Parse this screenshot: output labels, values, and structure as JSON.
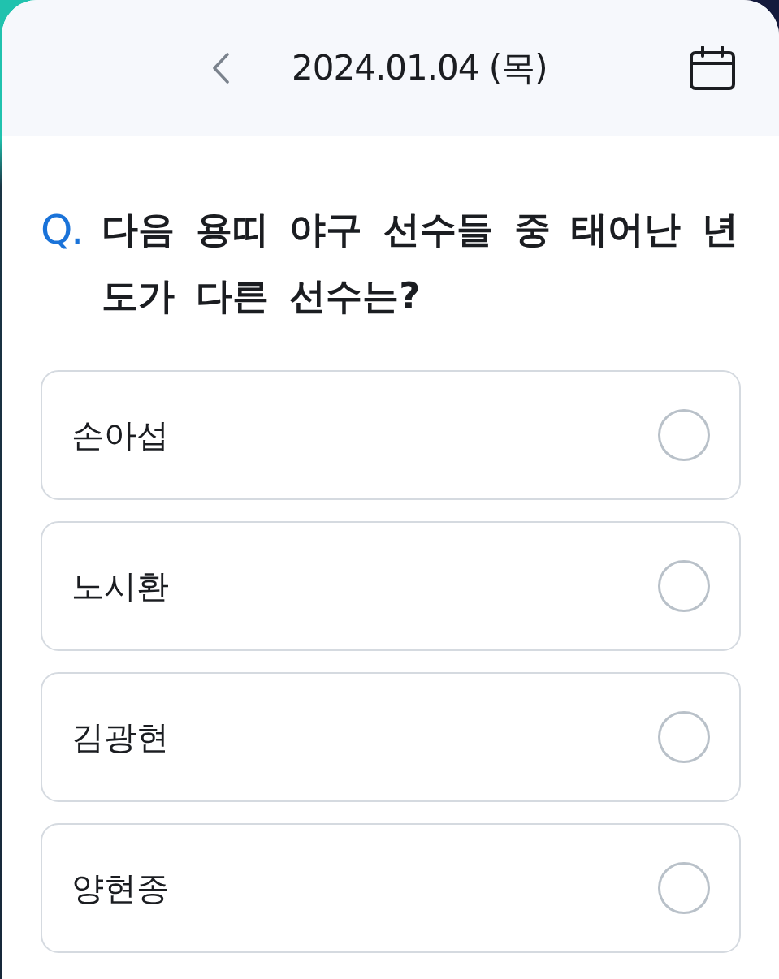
{
  "header": {
    "date": "2024.01.04 (목)"
  },
  "question": {
    "prefix": "Q.",
    "text": "다음 용띠 야구 선수들 중 태어난 년도가 다른 선수는?"
  },
  "options": [
    {
      "label": "손아섭",
      "selected": false
    },
    {
      "label": "노시환",
      "selected": false
    },
    {
      "label": "김광현",
      "selected": false
    },
    {
      "label": "양현종",
      "selected": false
    }
  ]
}
